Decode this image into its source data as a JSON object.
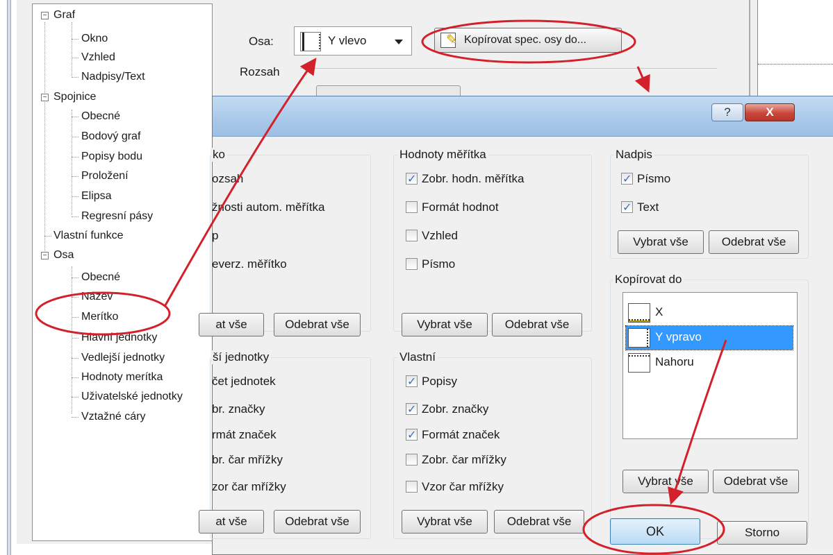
{
  "tree": [
    {
      "label": "Graf",
      "level": 0,
      "expander": "⊟"
    },
    {
      "label": "Okno",
      "level": 1
    },
    {
      "label": "Vzhled",
      "level": 1
    },
    {
      "label": "Nadpisy/Text",
      "level": 1
    },
    {
      "label": "Spojnice",
      "level": 0,
      "expander": "⊟"
    },
    {
      "label": "Obecné",
      "level": 1
    },
    {
      "label": "Bodový graf",
      "level": 1
    },
    {
      "label": "Popisy bodu",
      "level": 1
    },
    {
      "label": "Proložení",
      "level": 1
    },
    {
      "label": "Elipsa",
      "level": 1
    },
    {
      "label": "Regresní pásy",
      "level": 1
    },
    {
      "label": "Vlastní funkce",
      "level": 0
    },
    {
      "label": "Osa",
      "level": 0,
      "expander": "⊟"
    },
    {
      "label": "Obecné",
      "level": 1
    },
    {
      "label": "Název",
      "level": 1
    },
    {
      "label": "Merítko",
      "level": 1
    },
    {
      "label": "Hlavní jednotky",
      "level": 1
    },
    {
      "label": "Vedlejší jednotky",
      "level": 1
    },
    {
      "label": "Hodnoty merítka",
      "level": 1
    },
    {
      "label": "Uživatelské jednotky",
      "level": 1
    },
    {
      "label": "Vztažné cáry",
      "level": 1
    }
  ],
  "axis": {
    "label": "Osa:",
    "value": "Y vlevo"
  },
  "copy_spec_button": "Kopírovat spec. osy do...",
  "range_label": "Rozsah",
  "dialog": {
    "groups": {
      "scale": {
        "title_fragment": "ko",
        "items": [
          {
            "label": "ozsah",
            "checked": false
          },
          {
            "label": "žnosti autom. měřítka",
            "checked": false
          },
          {
            "label": "p",
            "checked": false
          },
          {
            "label": "everz. měřítko",
            "checked": false
          }
        ],
        "select_all": "at vše",
        "deselect_all": "Odebrat vše"
      },
      "scale_values": {
        "title": "Hodnoty měřítka",
        "items": [
          {
            "label": "Zobr. hodn. měřítka",
            "checked": true
          },
          {
            "label": "Formát hodnot",
            "checked": false
          },
          {
            "label": "Vzhled",
            "checked": false
          },
          {
            "label": "Písmo",
            "checked": false
          }
        ],
        "select_all": "Vybrat vše",
        "deselect_all": "Odebrat vše"
      },
      "caption": {
        "title": "Nadpis",
        "items": [
          {
            "label": "Písmo",
            "checked": true
          },
          {
            "label": "Text",
            "checked": true
          }
        ],
        "select_all": "Vybrat vše",
        "deselect_all": "Odebrat vše"
      },
      "minor_units": {
        "title_fragment": "ší jednotky",
        "items": [
          {
            "label": "čet jednotek"
          },
          {
            "label": "br. značky"
          },
          {
            "label": "rmát značek"
          },
          {
            "label": "br. čar mřížky"
          },
          {
            "label": "zor čar mřížky"
          }
        ],
        "select_all": "at vše",
        "deselect_all": "Odebrat vše"
      },
      "custom": {
        "title": "Vlastní",
        "items": [
          {
            "label": "Popisy",
            "checked": true
          },
          {
            "label": "Zobr. značky",
            "checked": true
          },
          {
            "label": "Formát značek",
            "checked": true
          },
          {
            "label": "Zobr. čar mřížky",
            "checked": false
          },
          {
            "label": "Vzor čar mřížky",
            "checked": false
          }
        ],
        "select_all": "Vybrat vše",
        "deselect_all": "Odebrat vše"
      },
      "copy_to": {
        "title": "Kopírovat do",
        "items": [
          {
            "label": "X",
            "selected": false
          },
          {
            "label": "Y vpravo",
            "selected": true
          },
          {
            "label": "Nahoru",
            "selected": false
          }
        ],
        "select_all": "Vybrat vše",
        "deselect_all": "Odebrat vše"
      }
    },
    "help_label": "?",
    "close_label": "X",
    "ok_label": "OK",
    "cancel_label": "Storno"
  },
  "annotation_color": "#d4202a"
}
